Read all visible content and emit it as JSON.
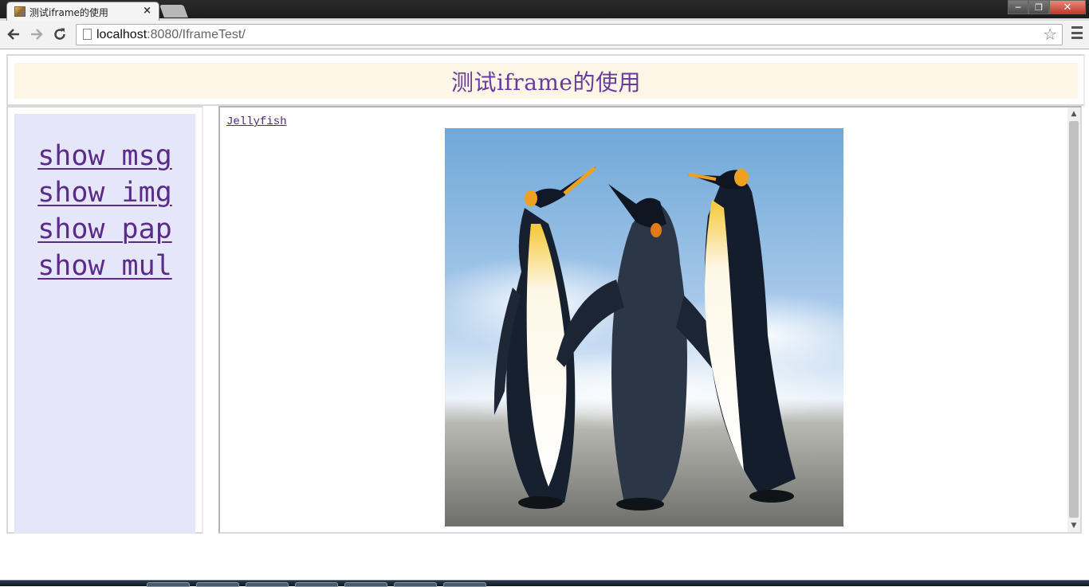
{
  "browser": {
    "tab_title": "测试iframe的使用",
    "tab_close": "×",
    "url_host": "localhost",
    "url_rest": ":8080/IframeTest/",
    "window_minimize": "─",
    "window_restore": "❐",
    "window_close": "✕"
  },
  "page": {
    "header_title": "测试iframe的使用",
    "nav": {
      "links": [
        "show msg",
        "show img",
        "show pap",
        "show mul"
      ]
    },
    "main": {
      "link_text": "Jellyfish",
      "image_subject": "three king penguins"
    }
  },
  "icons": {
    "back": "back-arrow-icon",
    "forward": "forward-arrow-icon",
    "reload": "reload-icon",
    "page": "page-icon",
    "star": "bookmark-star-icon",
    "menu": "hamburger-menu-icon"
  },
  "colors": {
    "header_bg": "#fdf5e6",
    "nav_bg": "#e6e6fa",
    "link_color": "#5b2b8a",
    "title_color": "#6a3a9e"
  }
}
